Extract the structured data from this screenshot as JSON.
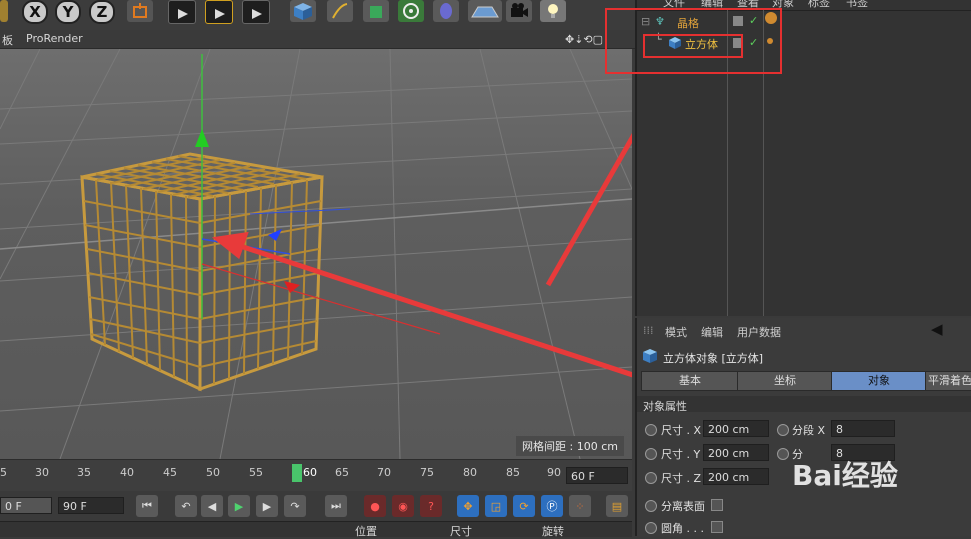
{
  "viewport": {
    "menu_fragment": "板",
    "renderer": "ProRender",
    "grid_label": "网格间距 : 100 cm"
  },
  "timeline": {
    "ticks": [
      "5",
      "30",
      "35",
      "40",
      "45",
      "50",
      "55",
      "60",
      "65",
      "70",
      "75",
      "80",
      "85",
      "90"
    ],
    "current_frame": "60",
    "frame_field": "60 F",
    "start_field": "0 F",
    "end_field": "90 F"
  },
  "coords": {
    "position": "位置",
    "size": "尺寸",
    "rotation": "旋转"
  },
  "object_manager": {
    "menu": [
      "文件",
      "编辑",
      "查看",
      "对象",
      "标签",
      "书签"
    ],
    "objects": [
      {
        "name": "晶格",
        "color": "#e0a23a"
      },
      {
        "name": "立方体",
        "color": "#f0c040"
      }
    ]
  },
  "attributes": {
    "menu": [
      "模式",
      "编辑",
      "用户数据"
    ],
    "title": "立方体对象 [立方体]",
    "tabs": [
      "基本",
      "坐标",
      "对象",
      "平滑着色"
    ],
    "active_tab": "对象",
    "section": "对象属性",
    "size_rows": [
      {
        "label": "尺寸 . X",
        "value": "200 cm"
      },
      {
        "label": "尺寸 . Y",
        "value": "200 cm"
      },
      {
        "label": "尺寸 . Z",
        "value": "200 cm"
      }
    ],
    "segment_rows": [
      {
        "label": "分段 X",
        "value": "8"
      },
      {
        "label": "分",
        "value": "8"
      }
    ],
    "separate_surfaces": "分离表面",
    "fillet": "圆角 . . ."
  },
  "watermark": "Bai经验"
}
